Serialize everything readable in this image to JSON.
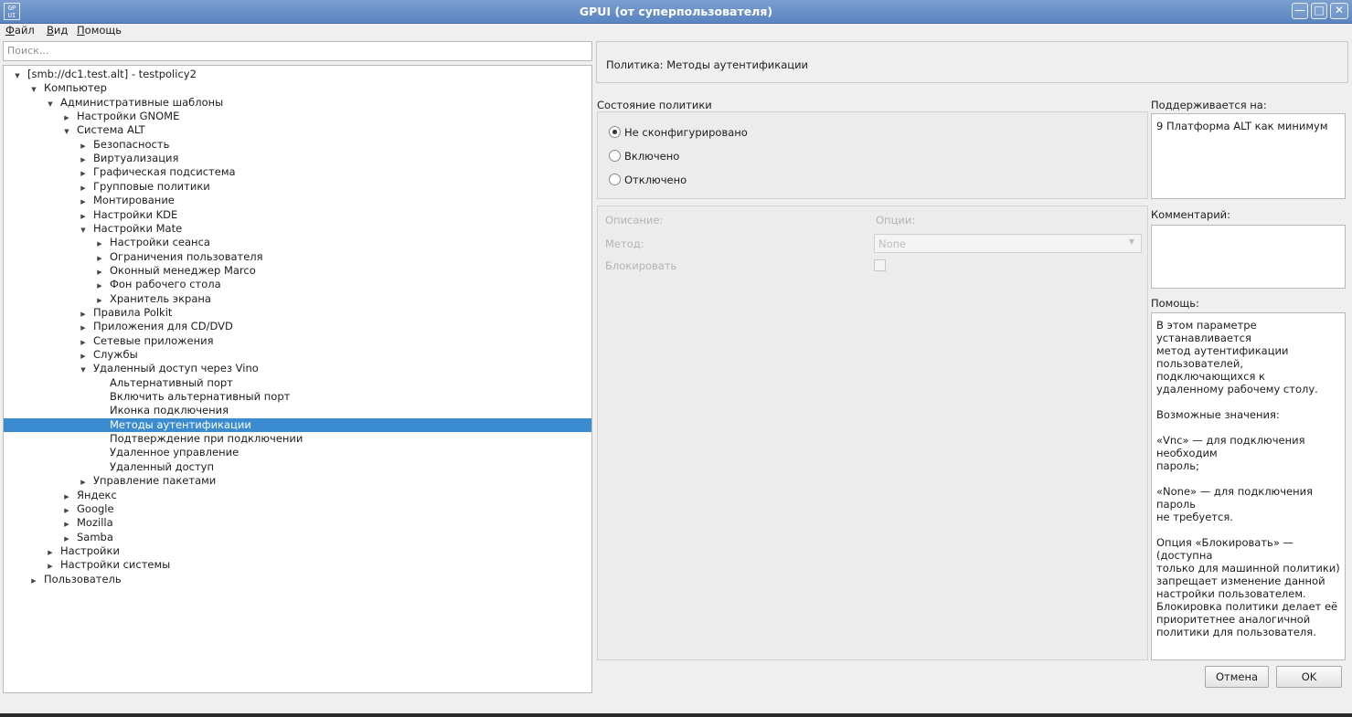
{
  "window": {
    "icon_text": "GP\nUI",
    "title": "GPUI (от суперпользователя)",
    "controls": [
      "minimize",
      "maximize",
      "close"
    ]
  },
  "menu": [
    "Файл",
    "Вид",
    "Помощь"
  ],
  "search": {
    "placeholder": "Поиск..."
  },
  "tree": [
    {
      "label": "[smb://dc1.test.alt] - testpolicy2",
      "level": 0,
      "arrow": "down"
    },
    {
      "label": "Компьютер",
      "level": 1,
      "arrow": "down"
    },
    {
      "label": "Административные шаблоны",
      "level": 2,
      "arrow": "down"
    },
    {
      "label": "Настройки GNOME",
      "level": 3,
      "arrow": "right"
    },
    {
      "label": "Система ALT",
      "level": 3,
      "arrow": "down"
    },
    {
      "label": "Безопасность",
      "level": 4,
      "arrow": "right"
    },
    {
      "label": "Виртуализация",
      "level": 4,
      "arrow": "right"
    },
    {
      "label": "Графическая подсистема",
      "level": 4,
      "arrow": "right"
    },
    {
      "label": "Групповые политики",
      "level": 4,
      "arrow": "right"
    },
    {
      "label": "Монтирование",
      "level": 4,
      "arrow": "right"
    },
    {
      "label": "Настройки KDE",
      "level": 4,
      "arrow": "right"
    },
    {
      "label": "Настройки Mate",
      "level": 4,
      "arrow": "down"
    },
    {
      "label": "Настройки сеанса",
      "level": 5,
      "arrow": "right"
    },
    {
      "label": "Ограничения пользователя",
      "level": 5,
      "arrow": "right"
    },
    {
      "label": "Оконный менеджер Marco",
      "level": 5,
      "arrow": "right"
    },
    {
      "label": "Фон рабочего стола",
      "level": 5,
      "arrow": "right"
    },
    {
      "label": "Хранитель экрана",
      "level": 5,
      "arrow": "right"
    },
    {
      "label": "Правила Polkit",
      "level": 4,
      "arrow": "right"
    },
    {
      "label": "Приложения для CD/DVD",
      "level": 4,
      "arrow": "right"
    },
    {
      "label": "Сетевые приложения",
      "level": 4,
      "arrow": "right"
    },
    {
      "label": "Службы",
      "level": 4,
      "arrow": "right"
    },
    {
      "label": "Удаленный доступ через Vino",
      "level": 4,
      "arrow": "down"
    },
    {
      "label": "Альтернативный порт",
      "level": 5,
      "arrow": ""
    },
    {
      "label": "Включить альтернативный порт",
      "level": 5,
      "arrow": ""
    },
    {
      "label": "Иконка подключения",
      "level": 5,
      "arrow": ""
    },
    {
      "label": "Методы аутентификации",
      "level": 5,
      "arrow": "",
      "selected": true
    },
    {
      "label": "Подтверждение при подключении",
      "level": 5,
      "arrow": ""
    },
    {
      "label": "Удаленное управление",
      "level": 5,
      "arrow": ""
    },
    {
      "label": "Удаленный доступ",
      "level": 5,
      "arrow": ""
    },
    {
      "label": "Управление пакетами",
      "level": 4,
      "arrow": "right"
    },
    {
      "label": "Яндекс",
      "level": 3,
      "arrow": "right"
    },
    {
      "label": "Google",
      "level": 3,
      "arrow": "right"
    },
    {
      "label": "Mozilla",
      "level": 3,
      "arrow": "right"
    },
    {
      "label": "Samba",
      "level": 3,
      "arrow": "right"
    },
    {
      "label": "Настройки",
      "level": 2,
      "arrow": "right"
    },
    {
      "label": "Настройки системы",
      "level": 2,
      "arrow": "right"
    },
    {
      "label": "Пользователь",
      "level": 1,
      "arrow": "right"
    }
  ],
  "policy": {
    "title": "Политика: Методы аутентификации"
  },
  "state": {
    "heading": "Состояние политики",
    "options": [
      {
        "label": "Не сконфигурировано",
        "checked": true
      },
      {
        "label": "Включено",
        "checked": false
      },
      {
        "label": "Отключено",
        "checked": false
      }
    ]
  },
  "options_panel": {
    "description_label": "Описание:",
    "options_label": "Опции:",
    "method_label": "Метод:",
    "method_value": "None",
    "lock_label": "Блокировать"
  },
  "supported": {
    "heading": "Поддерживается на:",
    "value": "9 Платформа ALT как минимум"
  },
  "comment": {
    "heading": "Комментарий:",
    "value": ""
  },
  "help": {
    "heading": "Помощь:",
    "text": "В этом параметре устанавливается\nметод аутентификации\nпользователей, подключающихся к\nудаленному рабочему столу.\n\nВозможные значения:\n\n«Vnc» — для подключения необходим\nпароль;\n\n«None» — для подключения пароль\nне требуется.\n\nОпция «Блокировать» — (доступна\nтолько для машинной политики)\nзапрещает изменение данной\nнастройки пользователем.\nБлокировка политики делает её\nприоритетнее аналогичной\nполитики для пользователя."
  },
  "buttons": {
    "cancel": "Отмена",
    "ok": "OK"
  }
}
